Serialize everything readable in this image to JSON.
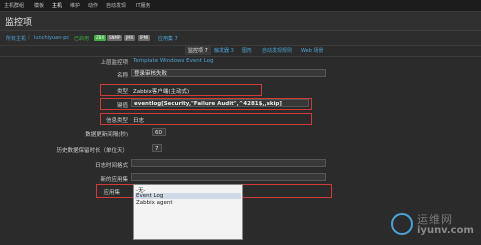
{
  "nav": {
    "items": [
      "主机群组",
      "模板",
      "主机",
      "维护",
      "动作",
      "自动发现",
      "IT服务"
    ]
  },
  "page": {
    "title": "监控项"
  },
  "breadcrumbs": {
    "all_hosts": "所有主机",
    "host": "lunchiyuan-pc",
    "enabled": "已启用",
    "badges": [
      "ZBX",
      "SNMP",
      "JMX",
      "IPMI"
    ],
    "links": [
      "应用集 7",
      "监控项 7",
      "触发器 3",
      "图形",
      "自动发现规则",
      "Web 场景"
    ]
  },
  "form": {
    "parent_label": "上层监控项",
    "parent_value": "Template Windows Event Log",
    "name_label": "名称",
    "name_value": "登录审核失败",
    "type_label": "类型",
    "type_value": "Zabbix客户端(主动式)",
    "key_label": "键值",
    "key_value": "eventlog[Security,\"Failure Audit\",^4281$,,skip]",
    "info_type_label": "信息类型",
    "info_type_value": "日志",
    "update_interval_label": "数据更新间隔(秒)",
    "update_interval_value": "60",
    "history_label": "历史数据保留时长（单位天）",
    "history_value": "7",
    "log_time_format_label": "日志时间格式",
    "new_app_label": "新的应用集",
    "apps_label": "应用集",
    "apps_options": [
      "-无-",
      "Event Log",
      "Zabbix agent"
    ],
    "apps_selected": "Event Log"
  },
  "watermark": {
    "text_cn": "运维网",
    "text_en": "iyunv.com"
  },
  "colors": {
    "link": "#4aa3d7",
    "highlight": "#d23a3a",
    "enabled": "#3fae3f",
    "badge_zbx": "#3fae3f",
    "badge_other": "#6a6a6a"
  }
}
